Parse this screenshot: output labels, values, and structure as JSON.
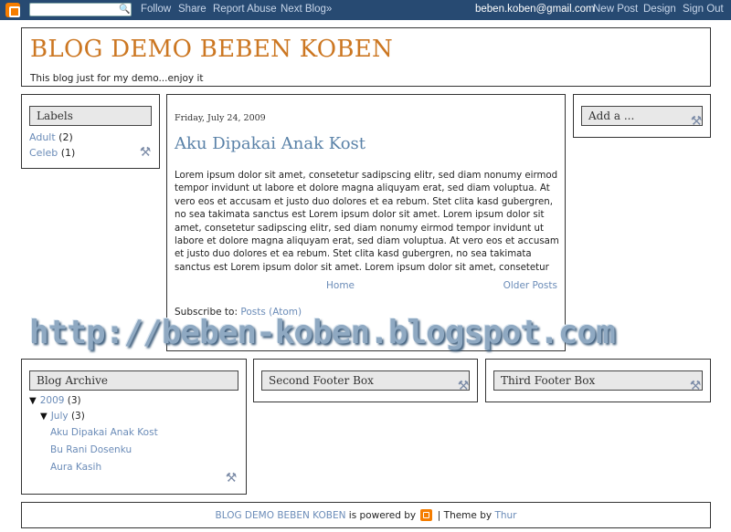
{
  "navbar": {
    "search_placeholder": "",
    "links": [
      "Follow",
      "Share",
      "Report Abuse",
      "Next Blog»"
    ],
    "email": "beben.koben@gmail.com",
    "right_links": [
      "New Post",
      "Design",
      "Sign Out"
    ]
  },
  "header": {
    "title": "BLOG DEMO BEBEN KOBEN",
    "description": "This blog just for my demo...enjoy it"
  },
  "labels_widget": {
    "title": "Labels",
    "items": [
      {
        "name": "Adult",
        "count": "(2)"
      },
      {
        "name": "Celeb",
        "count": "(1)"
      }
    ]
  },
  "post": {
    "date": "Friday, July 24, 2009",
    "title": "Aku Dipakai Anak Kost",
    "body": "Lorem ipsum dolor sit amet, consetetur sadipscing elitr, sed diam nonumy eirmod tempor invidunt ut labore et dolore magna aliquyam erat, sed diam voluptua. At vero eos et accusam et justo duo dolores et ea rebum. Stet clita kasd gubergren, no sea takimata sanctus est Lorem ipsum dolor sit amet. Lorem ipsum dolor sit amet, consetetur sadipscing elitr, sed diam nonumy eirmod tempor invidunt ut labore et dolore magna aliquyam erat, sed diam voluptua. At vero eos et accusam et justo duo dolores et ea rebum. Stet clita kasd gubergren, no sea takimata sanctus est Lorem ipsum dolor sit amet. Lorem ipsum dolor sit amet, consetetur",
    "home_label": "Home",
    "older_label": "Older Posts",
    "subscribe_label": "Subscribe to:",
    "subscribe_link": "Posts (Atom)"
  },
  "sidebar_right": {
    "title": "Add a ..."
  },
  "watermark": "http://beben-koben.blogspot.com",
  "archive": {
    "title": "Blog Archive",
    "year": "2009",
    "year_count": "(3)",
    "month": "July",
    "month_count": "(3)",
    "posts": [
      "Aku Dipakai Anak Kost",
      "Bu Rani Dosenku",
      "Aura Kasih"
    ]
  },
  "footer_boxes": {
    "second": "Second Footer Box",
    "third": "Third Footer Box"
  },
  "footer": {
    "blog_name": "BLOG DEMO BEBEN KOBEN",
    "powered_text": "is powered by",
    "theme_text": "| Theme by",
    "theme_author": "Thur"
  },
  "colors": {
    "navbar_bg": "#274a72",
    "title_color": "#cc7722",
    "link_color": "#6b8cb8",
    "blogger_orange": "#f57d00"
  },
  "icons": [
    "blogger-logo-icon",
    "search-icon",
    "tools-icon",
    "triangle-down-icon"
  ]
}
